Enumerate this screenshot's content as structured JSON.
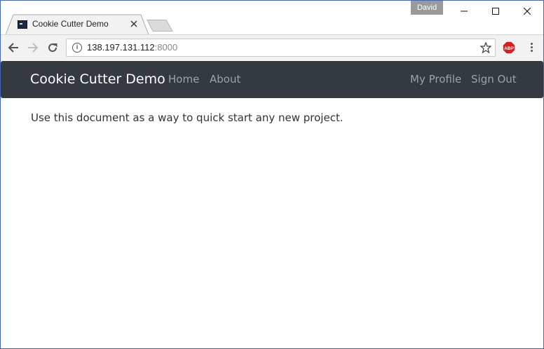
{
  "browser": {
    "profile_name": "David",
    "tab": {
      "title": "Cookie Cutter Demo"
    },
    "address_bar": {
      "host": "138.197.131.112",
      "port": ":8000"
    },
    "extensions": {
      "adblock_label": "ABP"
    }
  },
  "page": {
    "navbar": {
      "brand": "Cookie Cutter Demo",
      "left_links": [
        "Home",
        "About"
      ],
      "right_links": [
        "My Profile",
        "Sign Out"
      ]
    },
    "body_text": "Use this document as a way to quick start any new project."
  },
  "colors": {
    "navbar_bg": "#343a40",
    "nav_link": "#9ea2a6",
    "window_border": "#4a64b0",
    "adblock_red": "#d11f26"
  }
}
